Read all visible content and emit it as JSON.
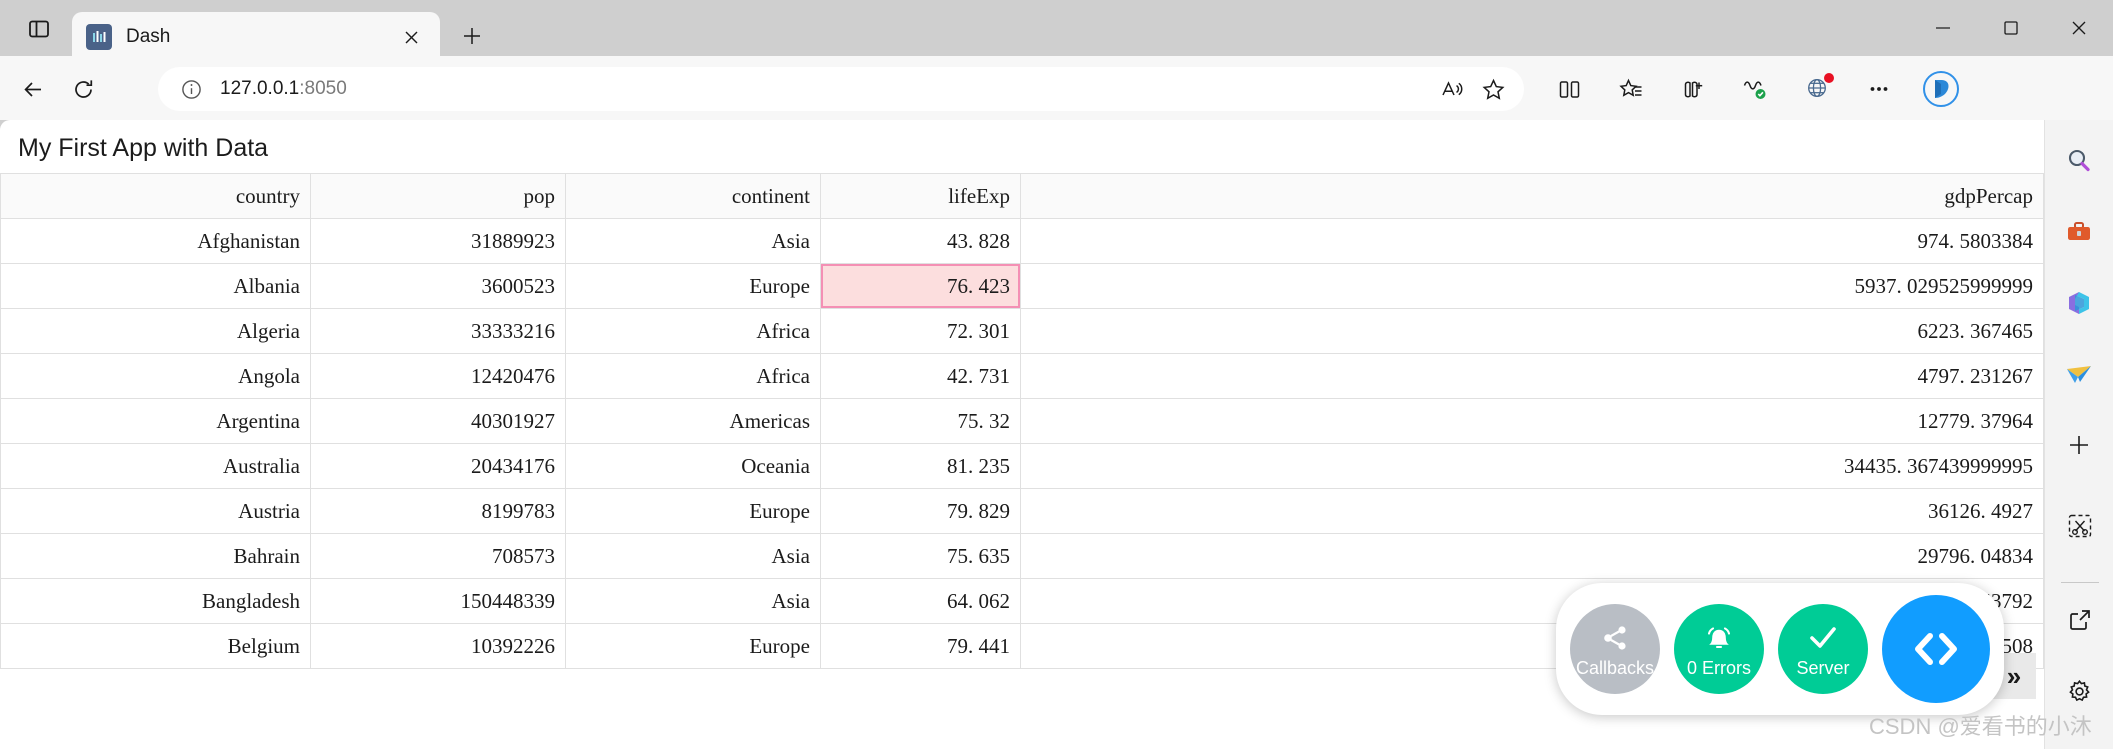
{
  "browser": {
    "tab": {
      "title": "Dash",
      "favicon": "dash-logo-icon"
    },
    "new_tab_label": "+",
    "url": {
      "protocol_host": "127.0.0.1",
      "port": ":8050",
      "full": "127.0.0.1:8050"
    },
    "window_controls": {
      "minimize": "—",
      "maximize": "☐",
      "close": "✕"
    },
    "toolbar_icons": [
      "read-aloud-icon",
      "favorites-star-icon",
      "split-screen-icon",
      "collections-icon",
      "browser-essentials-icon",
      "shopping-icon",
      "extension-icon",
      "more-settings-icon",
      "copilot-icon"
    ],
    "sidebar_icons": [
      "search-icon",
      "tools-briefcase-icon",
      "microsoft365-icon",
      "outlook-icon",
      "add-sidebar-app-icon"
    ],
    "sidebar_bottom_icons": [
      "screenshot-scissors-icon",
      "open-external-icon",
      "settings-gear-icon"
    ]
  },
  "page": {
    "title": "My First App with Data"
  },
  "table": {
    "columns": [
      "country",
      "pop",
      "continent",
      "lifeExp",
      "gdpPercap"
    ],
    "active_cell": {
      "row": 1,
      "column": "lifeExp",
      "value": "76. 423"
    },
    "rows": [
      {
        "country": "Afghanistan",
        "pop": "31889923",
        "continent": "Asia",
        "lifeExp": "43. 828",
        "gdpPercap": "974. 5803384"
      },
      {
        "country": "Albania",
        "pop": "3600523",
        "continent": "Europe",
        "lifeExp": "76. 423",
        "gdpPercap": "5937. 029525999999"
      },
      {
        "country": "Algeria",
        "pop": "33333216",
        "continent": "Africa",
        "lifeExp": "72. 301",
        "gdpPercap": "6223. 367465"
      },
      {
        "country": "Angola",
        "pop": "12420476",
        "continent": "Africa",
        "lifeExp": "42. 731",
        "gdpPercap": "4797. 231267"
      },
      {
        "country": "Argentina",
        "pop": "40301927",
        "continent": "Americas",
        "lifeExp": "75. 32",
        "gdpPercap": "12779. 37964"
      },
      {
        "country": "Australia",
        "pop": "20434176",
        "continent": "Oceania",
        "lifeExp": "81. 235",
        "gdpPercap": "34435. 367439999995"
      },
      {
        "country": "Austria",
        "pop": "8199783",
        "continent": "Europe",
        "lifeExp": "79. 829",
        "gdpPercap": "36126. 4927"
      },
      {
        "country": "Bahrain",
        "pop": "708573",
        "continent": "Asia",
        "lifeExp": "75. 635",
        "gdpPercap": "29796. 04834"
      },
      {
        "country": "Bangladesh",
        "pop": "150448339",
        "continent": "Asia",
        "lifeExp": "64. 062",
        "gdpPercap": "1391. 253792"
      },
      {
        "country": "Belgium",
        "pop": "10392226",
        "continent": "Europe",
        "lifeExp": "79. 441",
        "gdpPercap": "33692. 60508"
      }
    ]
  },
  "devtools": {
    "callbacks": {
      "label": "Callbacks",
      "icon": "share-graph-icon",
      "color": "#b9bec5"
    },
    "errors": {
      "label": "0 Errors",
      "icon": "bell-icon",
      "color": "#00cc96"
    },
    "server": {
      "label": "Server",
      "icon": "check-icon",
      "color": "#00cc96"
    },
    "code": {
      "label": "",
      "icon": "code-brackets-icon",
      "color": "#119dff"
    },
    "expander_label": "»"
  },
  "watermark": {
    "text": "CSDN @爱看书的小沐"
  }
}
